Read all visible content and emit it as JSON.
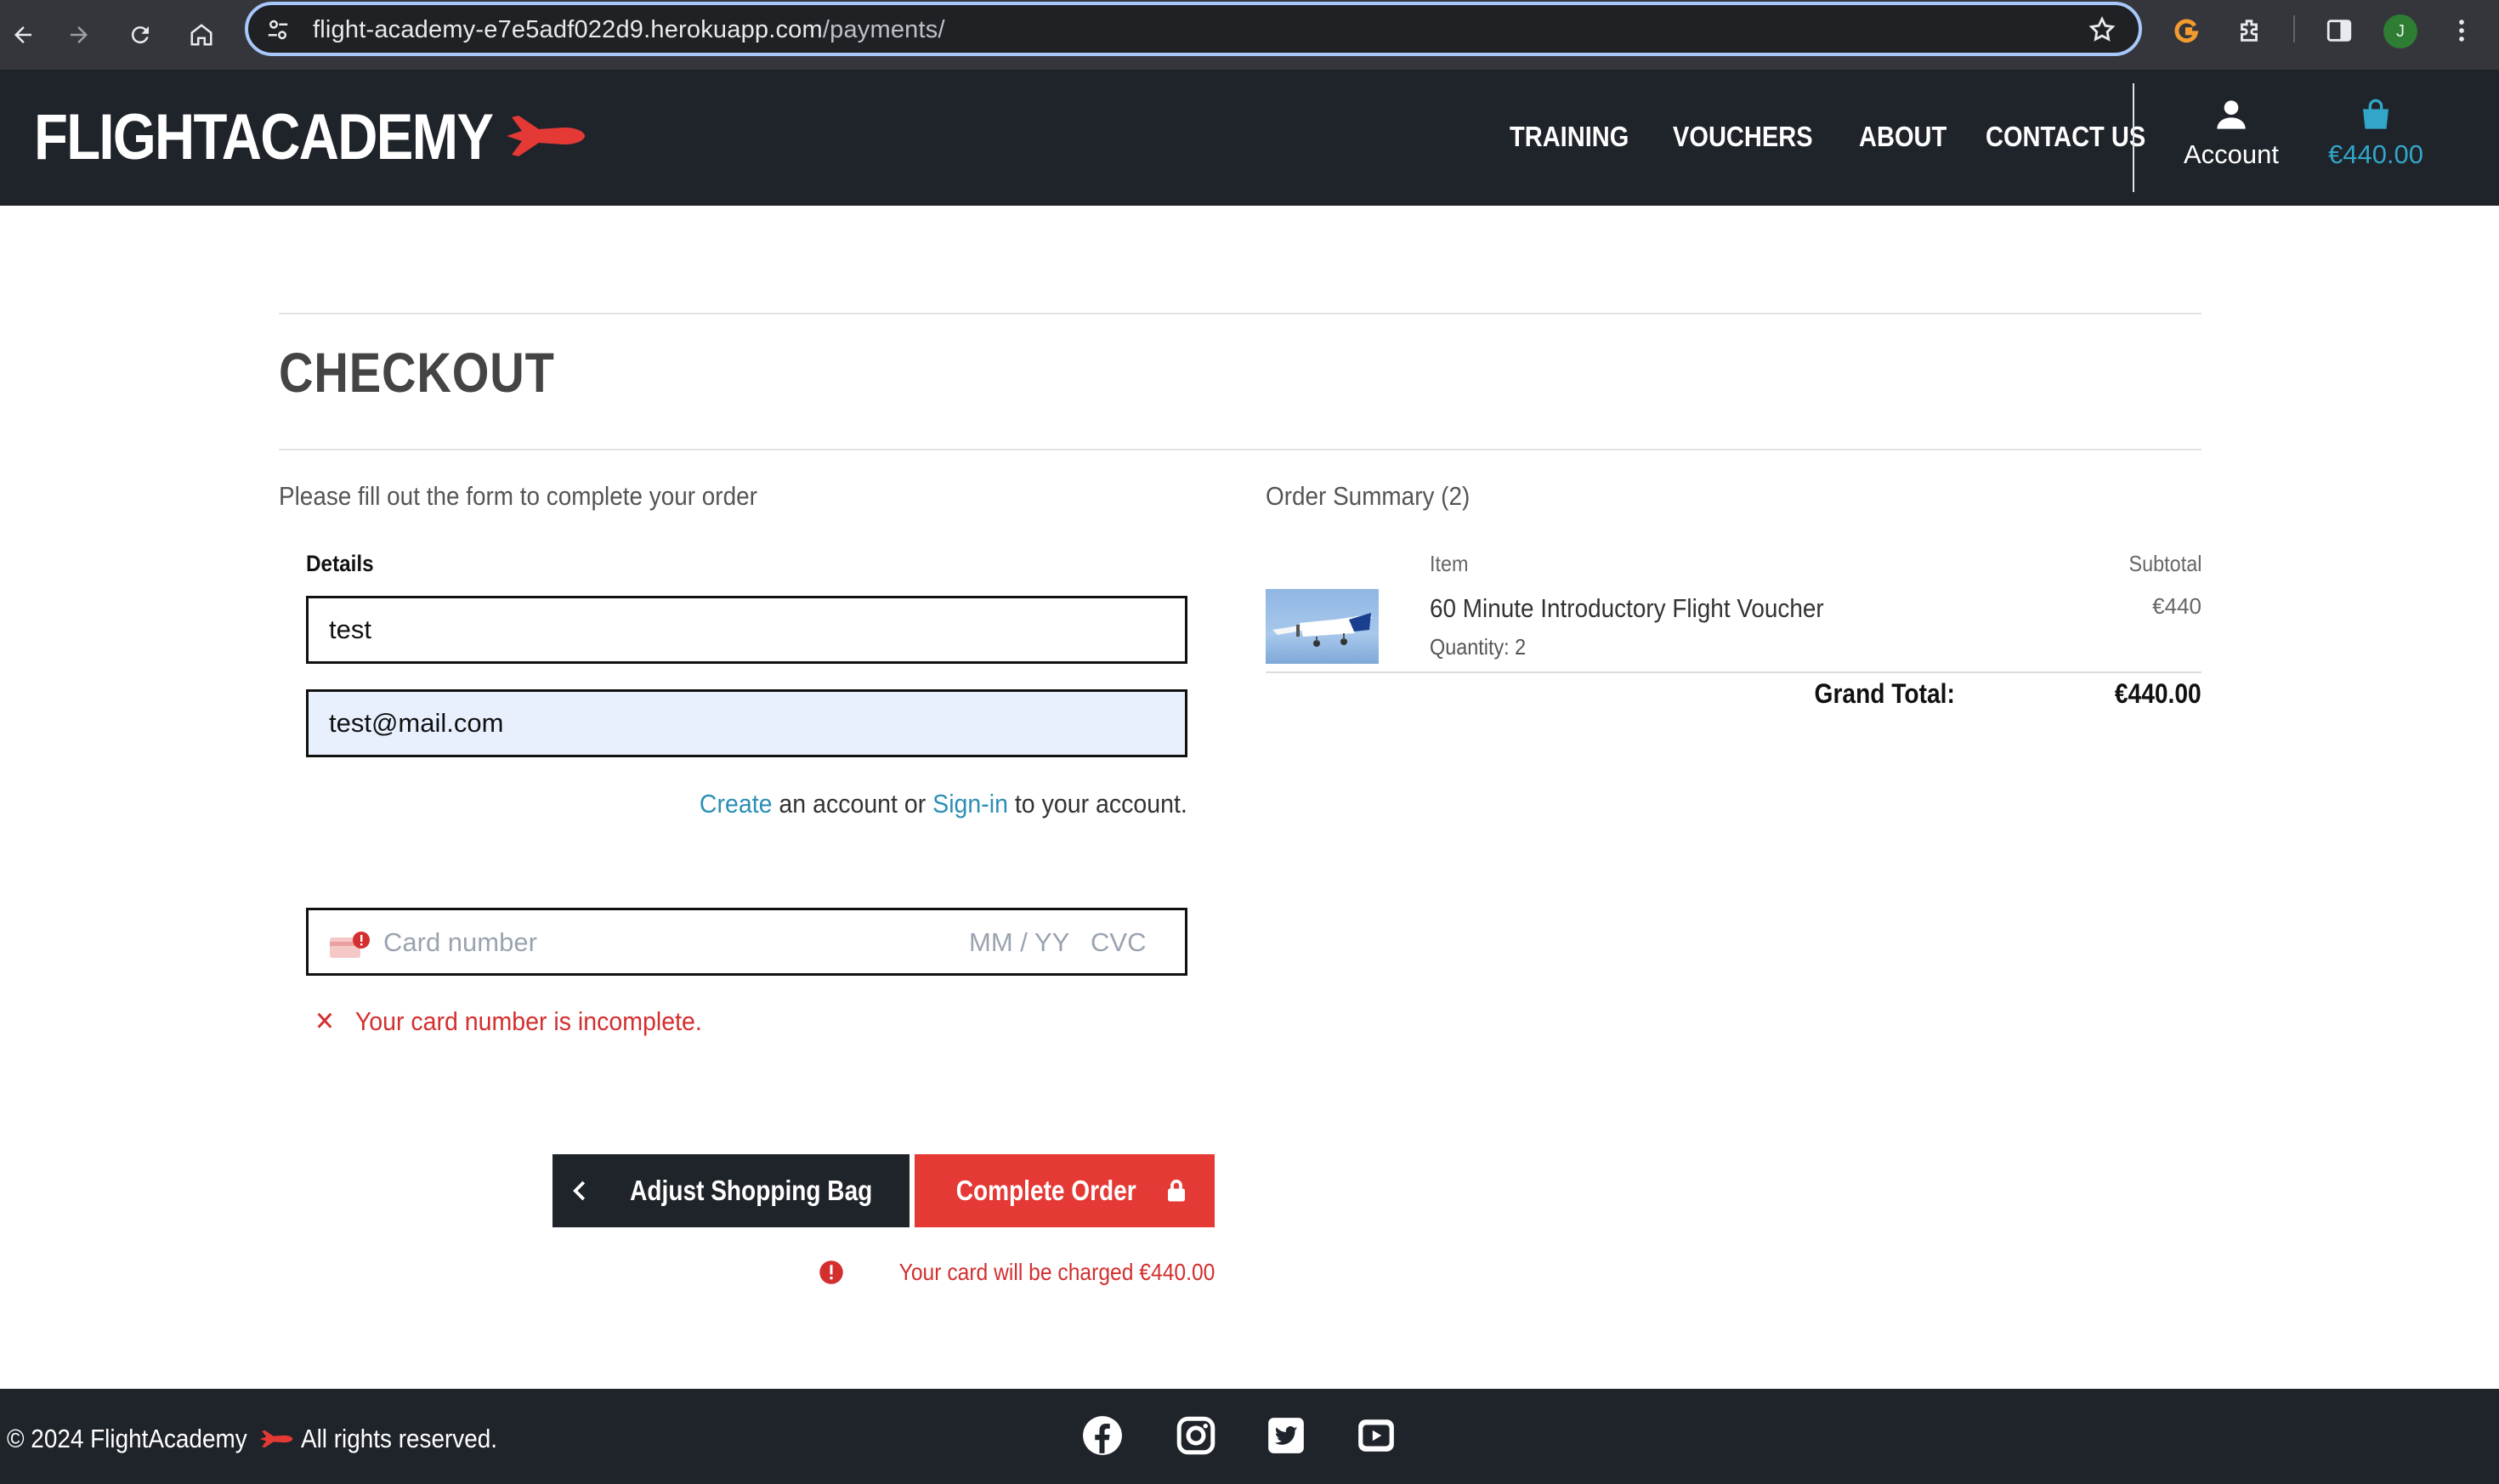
{
  "browser": {
    "url_host": "flight-academy-e7e5adf022d9.herokuapp.com",
    "url_path": "/payments/",
    "profile_initial": "J"
  },
  "header": {
    "logo_text": "FLIGHTACADEMY",
    "nav": [
      "TRAINING",
      "VOUCHERS",
      "ABOUT",
      "CONTACT US"
    ],
    "account_label": "Account",
    "bag_total": "€440.00",
    "accent_color": "#e53935",
    "bag_color": "#32a6c8"
  },
  "checkout": {
    "title": "CHECKOUT",
    "form_intro": "Please fill out the form to complete your order",
    "details_label": "Details",
    "name_value": "test",
    "email_value": "test@mail.com",
    "account_prompt": {
      "create_link": "Create",
      "middle": " an account or ",
      "signin_link": "Sign-in",
      "end": " to your account."
    },
    "card": {
      "number_placeholder": "Card number",
      "expiry_placeholder": "MM / YY",
      "cvc_placeholder": "CVC",
      "error": "Your card number is incomplete.",
      "error_icon": "x-icon"
    },
    "buttons": {
      "adjust": "Adjust Shopping Bag",
      "complete": "Complete Order"
    },
    "charge_note": "Your card will be charged €440.00"
  },
  "summary": {
    "title": "Order Summary (2)",
    "col_item": "Item",
    "col_subtotal": "Subtotal",
    "items": [
      {
        "name": "60 Minute Introductory Flight Voucher",
        "quantity": "Quantity: 2",
        "subtotal": "€440"
      }
    ],
    "grand_total_label": "Grand Total:",
    "grand_total_value": "€440.00"
  },
  "footer": {
    "copyright_pre": "© 2024 FlightAcademy",
    "copyright_post": "All rights reserved.",
    "social": [
      "facebook-icon",
      "instagram-icon",
      "twitter-icon",
      "youtube-icon"
    ]
  }
}
